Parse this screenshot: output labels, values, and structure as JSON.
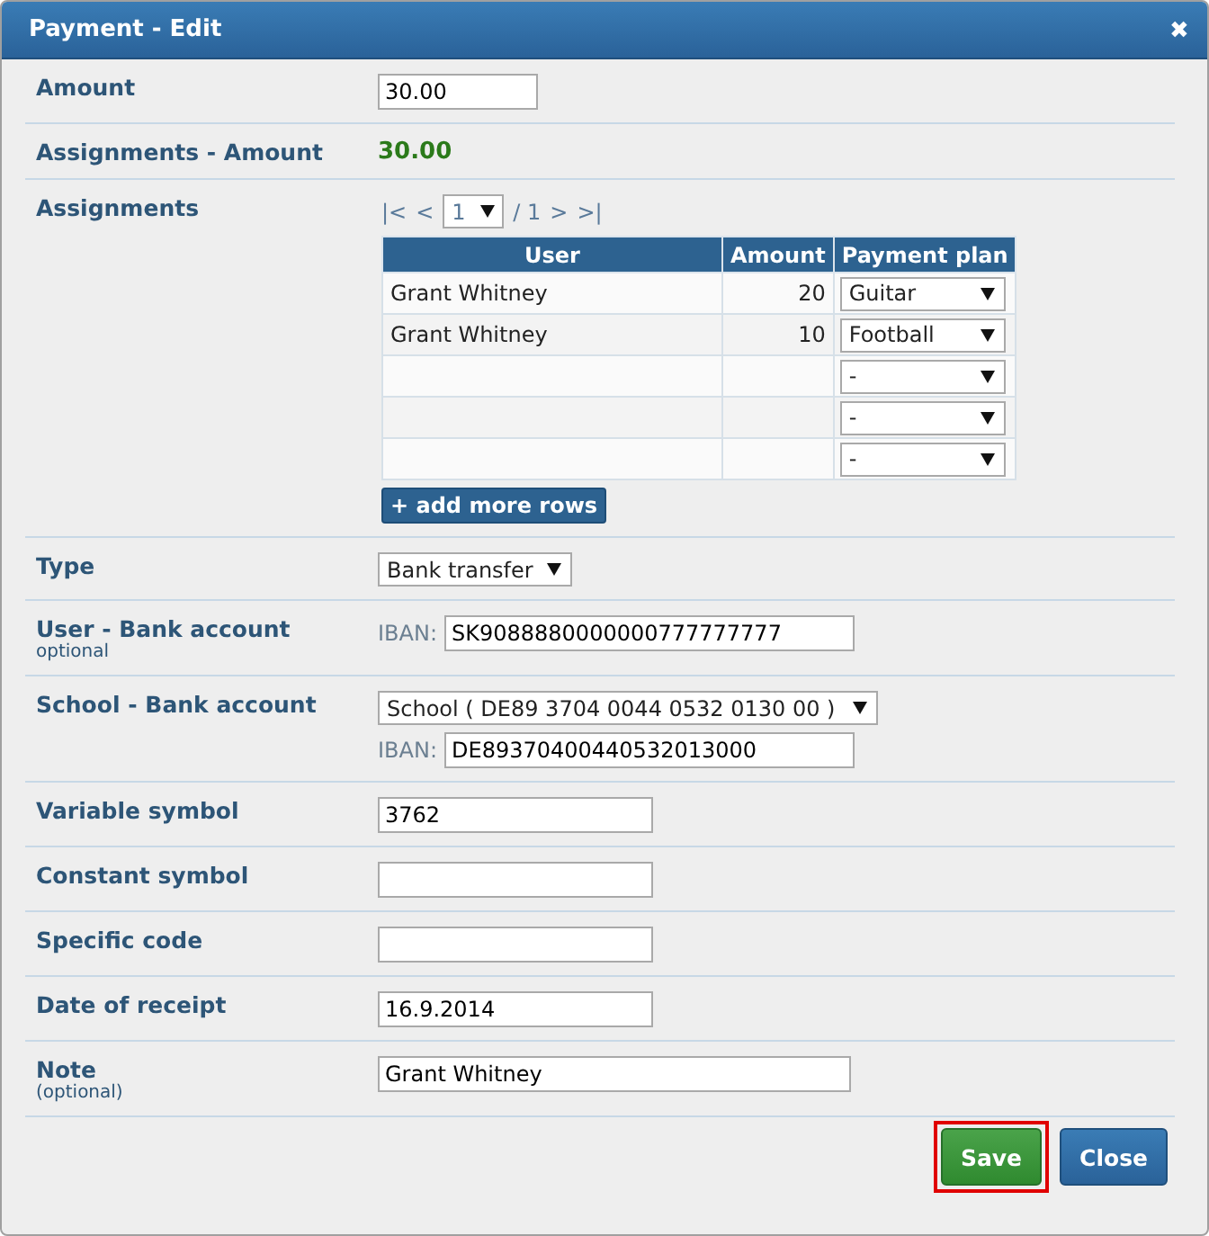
{
  "window": {
    "title": "Payment - Edit",
    "close": "✖"
  },
  "fields": [
    {
      "kind": "short_input",
      "label": "Amount",
      "value": "30.00"
    },
    {
      "kind": "text",
      "label": "Assignments - Amount",
      "value": "30.00"
    },
    {
      "kind": "assignments",
      "label": "Assignments",
      "pager": {
        "first": "|<",
        "prev": "<",
        "page": "1",
        "total": "/ 1",
        "next": ">",
        "last": ">|"
      },
      "columns": [
        "User",
        "Amount",
        "Payment plan"
      ],
      "rows": [
        {
          "user": "Grant Whitney",
          "amount": "20",
          "plan": "Guitar"
        },
        {
          "user": "Grant Whitney",
          "amount": "10",
          "plan": "Football"
        },
        {
          "user": "",
          "amount": "",
          "plan": "-"
        },
        {
          "user": "",
          "amount": "",
          "plan": "-"
        },
        {
          "user": "",
          "amount": "",
          "plan": "-"
        }
      ],
      "add_button": "+ add more rows"
    },
    {
      "kind": "select",
      "label": "Type",
      "value": "Bank transfer"
    },
    {
      "kind": "iban",
      "label": "User - Bank account",
      "sublabel": "optional",
      "iban_label": "IBAN:",
      "value": "SK9088880000000777777777"
    },
    {
      "kind": "select_iban",
      "label": "School - Bank account",
      "select": "School ( DE89 3704 0044 0532 0130 00 )",
      "iban_label": "IBAN:",
      "value": "DE89370400440532013000"
    },
    {
      "kind": "input",
      "label": "Variable symbol",
      "value": "3762"
    },
    {
      "kind": "input",
      "label": "Constant symbol"
    },
    {
      "kind": "input",
      "label": "Specific code"
    },
    {
      "kind": "input",
      "label": "Date of receipt",
      "value": "16.9.2014"
    },
    {
      "kind": "long_input",
      "label": "Note",
      "sublabel": "(optional)",
      "value": "Grant Whitney"
    }
  ],
  "buttons": [
    {
      "label": "Save",
      "kind": "primary",
      "highlighted": true
    },
    {
      "label": "Close",
      "kind": "secondary",
      "highlighted": false
    }
  ]
}
